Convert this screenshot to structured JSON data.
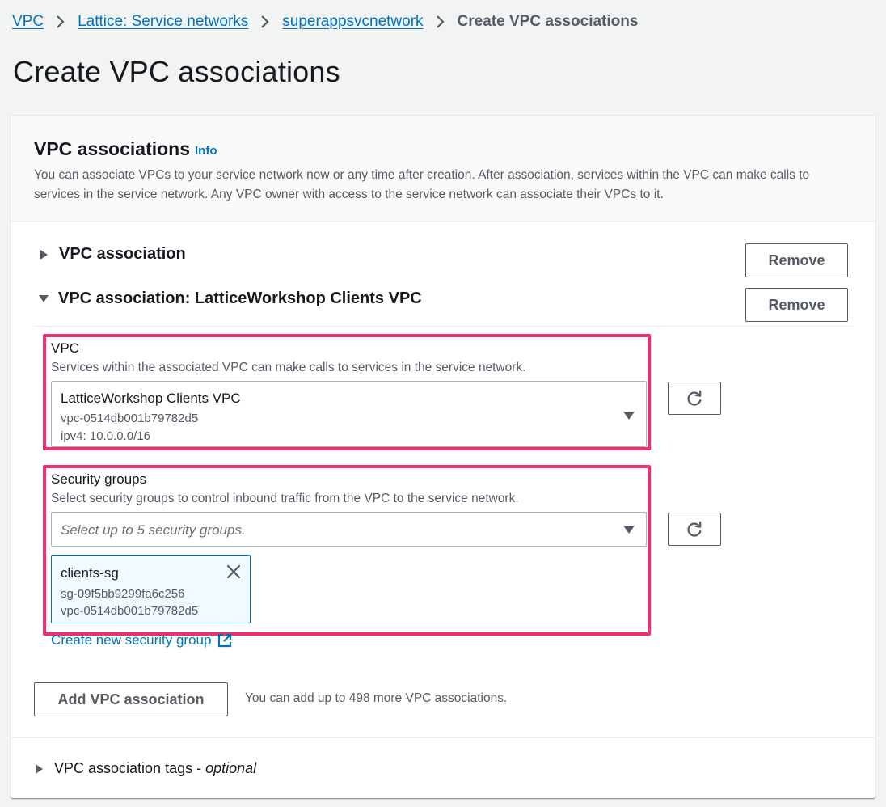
{
  "breadcrumb": {
    "items": [
      {
        "label": "VPC"
      },
      {
        "label": "Lattice: Service networks"
      },
      {
        "label": "superappsvcnetwork"
      }
    ],
    "current": "Create VPC associations"
  },
  "page": {
    "title": "Create VPC associations"
  },
  "section": {
    "title": "VPC associations",
    "info_label": "Info",
    "description": "You can associate VPCs to your service network now or any time after creation. After association, services within the VPC can make calls to services in the service network. Any VPC owner with access to the service network can associate their VPCs to it."
  },
  "associations": [
    {
      "title": "VPC association",
      "expanded": false,
      "remove_label": "Remove"
    },
    {
      "title": "VPC association: LatticeWorkshop Clients VPC",
      "expanded": true,
      "remove_label": "Remove"
    }
  ],
  "vpc_field": {
    "label": "VPC",
    "description": "Services within the associated VPC can make calls to services in the service network.",
    "selected": {
      "name": "LatticeWorkshop Clients VPC",
      "id": "vpc-0514db001b79782d5",
      "cidr": "ipv4: 10.0.0.0/16"
    }
  },
  "security_groups_field": {
    "label": "Security groups",
    "description": "Select security groups to control inbound traffic from the VPC to the service network.",
    "placeholder": "Select up to 5 security groups.",
    "tokens": [
      {
        "name": "clients-sg",
        "id": "sg-09f5bb9299fa6c256",
        "vpc": "vpc-0514db001b79782d5"
      }
    ],
    "create_link": "Create new security group"
  },
  "add_association": {
    "button_label": "Add VPC association",
    "hint": "You can add up to 498 more VPC associations."
  },
  "tags": {
    "title": "VPC association tags",
    "separator": " - ",
    "optional": "optional"
  },
  "colors": {
    "link": "#0073bb",
    "highlight": "#f0306e",
    "text_secondary": "#545b64",
    "background": "#f2f3f3"
  },
  "icons": [
    "chevron-right-icon",
    "caret-right-icon",
    "caret-down-icon",
    "refresh-icon",
    "close-icon",
    "external-link-icon"
  ]
}
